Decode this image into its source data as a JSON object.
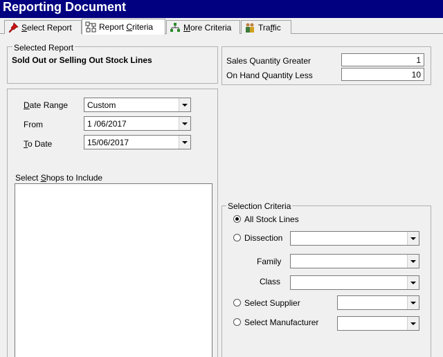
{
  "window": {
    "title": "Reporting Document"
  },
  "tabs": [
    {
      "label": "Select Report",
      "underline": "S",
      "rest": "elect Report",
      "icon": "pushpin-icon"
    },
    {
      "label": "Report Criteria",
      "prefix": "Report ",
      "underline": "C",
      "rest": "riteria",
      "icon": "report-criteria-icon"
    },
    {
      "label": "More Criteria",
      "underline": "M",
      "rest": "ore Criteria",
      "icon": "more-criteria-icon"
    },
    {
      "label": "Traffic",
      "prefix": "Tra",
      "underline": "f",
      "rest": "fic",
      "icon": "people-icon"
    }
  ],
  "selected_report": {
    "group_title": "Selected Report",
    "name": "Sold Out or Selling Out Stock Lines"
  },
  "quantities": {
    "sales_qty_label": "Sales Quantity Greater",
    "sales_qty_value": "1",
    "on_hand_label": "On Hand Quantity Less",
    "on_hand_value": "10"
  },
  "date_range": {
    "label": "Date Range",
    "underline": "D",
    "rest": "ate Range",
    "value": "Custom",
    "from_label": "From",
    "from_value": "1 /06/2017",
    "to_label": "To Date",
    "to_underline": "T",
    "to_rest": "o Date",
    "to_value": "15/06/2017"
  },
  "shops": {
    "label": "Select Shops to Include",
    "prefix": "Select ",
    "underline": "S",
    "rest": "hops to Include"
  },
  "selection_criteria": {
    "group_title": "Selection Criteria",
    "all_stock_label": "All Stock Lines",
    "dissection_label": "Dissection",
    "family_label": "Family",
    "class_label": "Class",
    "supplier_label": "Select Supplier",
    "manufacturer_label": "Select Manufacturer",
    "selected": "All Stock Lines"
  }
}
